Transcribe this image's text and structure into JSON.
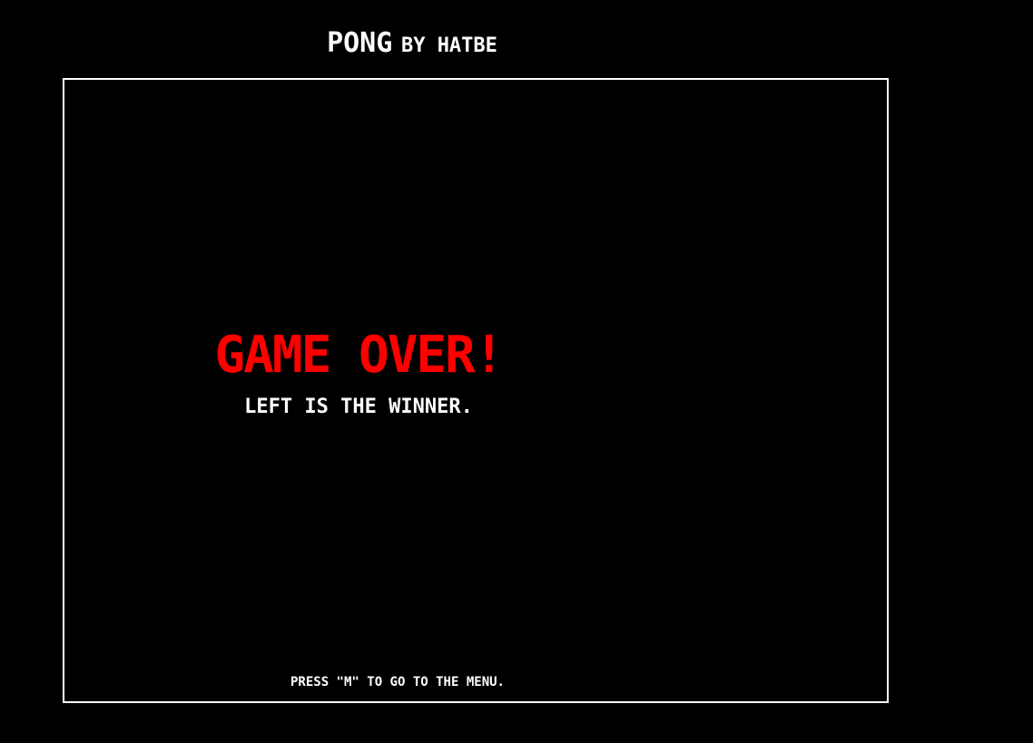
{
  "header": {
    "title_main": "PONG",
    "title_sub": "BY HATBE"
  },
  "game": {
    "headline": "GAME OVER!",
    "winner_message": "LEFT IS THE WINNER.",
    "menu_hint": "PRESS \"M\" TO GO TO THE MENU."
  },
  "colors": {
    "background": "#000000",
    "text": "#ffffff",
    "headline": "#ff0000",
    "border": "#ffffff"
  }
}
